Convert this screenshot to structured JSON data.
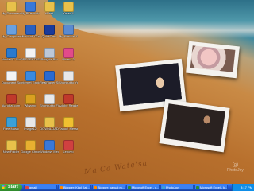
{
  "desktop": {
    "icons": [
      {
        "label": "My Documents",
        "icon": "folder-icon",
        "color": "#e8c14a"
      },
      {
        "label": "My Bluetooth",
        "icon": "bluetooth-icon",
        "color": "#3a78d8"
      },
      {
        "label": "sheet",
        "icon": "folder-icon",
        "color": "#e8c14a"
      },
      {
        "label": "Kelas 4",
        "icon": "folder-icon",
        "color": "#e8c14a"
      },
      {
        "label": "My Computer",
        "icon": "computer-icon",
        "color": "#6aa0e0"
      },
      {
        "label": "Microsoft Outlook",
        "icon": "outlook-icon",
        "color": "#2a5fbf"
      },
      {
        "label": "QuickTime",
        "icon": "quicktime-icon",
        "color": "#1a3a9a"
      },
      {
        "label": "My Network Places",
        "icon": "network-icon",
        "color": "#5a8ad0"
      },
      {
        "label": "Nokia PC Suite",
        "icon": "nokia-icon",
        "color": "#2a7ad0"
      },
      {
        "label": "PRESENTASI",
        "icon": "document-icon",
        "color": "#f4f4f4"
      },
      {
        "label": "Recycle Bin",
        "icon": "recycle-bin-icon",
        "color": "#bcc8d8"
      },
      {
        "label": "Picasa 3",
        "icon": "picasa-icon",
        "color": "#e24a8a"
      },
      {
        "label": "Document Scrap",
        "icon": "document-icon",
        "color": "#f4f4f4"
      },
      {
        "label": "Internet Explorer",
        "icon": "ie-icon",
        "color": "#3a8ae0"
      },
      {
        "label": "RealPlayer SP",
        "icon": "realplayer-icon",
        "color": "#2a6ad0"
      },
      {
        "label": "Shortcut to Yahoo",
        "icon": "shortcut-icon",
        "color": "#e8e8e8"
      },
      {
        "label": "Acrobat.com",
        "icon": "acrobat-icon",
        "color": "#c0392b"
      },
      {
        "label": "Winamp",
        "icon": "winamp-icon",
        "color": "#d9a020"
      },
      {
        "label": "Shortcut to FORM",
        "icon": "shortcut-icon",
        "color": "#e8e8e8"
      },
      {
        "label": "Adobe Reader 9",
        "icon": "adobe-reader-icon",
        "color": "#c0392b"
      },
      {
        "label": "Free Music",
        "icon": "music-icon",
        "color": "#3aa0d8"
      },
      {
        "label": "Image12",
        "icon": "image-icon",
        "color": "#e8e8e8"
      },
      {
        "label": "DOWNLOAD",
        "icon": "download-icon",
        "color": "#e8c14a"
      },
      {
        "label": "Yahoo! Messenger",
        "icon": "messenger-icon",
        "color": "#f0c030"
      },
      {
        "label": "New Folder",
        "icon": "folder-icon",
        "color": "#e8c14a"
      },
      {
        "label": "Google Chrome",
        "icon": "chrome-icon",
        "color": "#e8b030"
      },
      {
        "label": "Windows Media Player",
        "icon": "media-player-icon",
        "color": "#3a78d8"
      },
      {
        "label": "Lenovo",
        "icon": "app-icon",
        "color": "#d04040"
      }
    ],
    "sand_text": "Ma'Ca Wate'sa",
    "watermark": "PhotoJoy"
  },
  "taskbar": {
    "start_label": "start",
    "tasks": [
      {
        "label": "gmail",
        "color": "#d44"
      },
      {
        "label": "Blogger: Kind Kat...",
        "color": "#f80"
      },
      {
        "label": "Blogger: kasuat m...",
        "color": "#f80"
      },
      {
        "label": "Microsoft Excel - g...",
        "color": "#2a8a3a"
      },
      {
        "label": "PhotoJoy",
        "color": "#3aa0d8"
      },
      {
        "label": "Microsoft Excel - k...",
        "color": "#2a8a3a"
      }
    ],
    "clock": "3:17 PM"
  }
}
